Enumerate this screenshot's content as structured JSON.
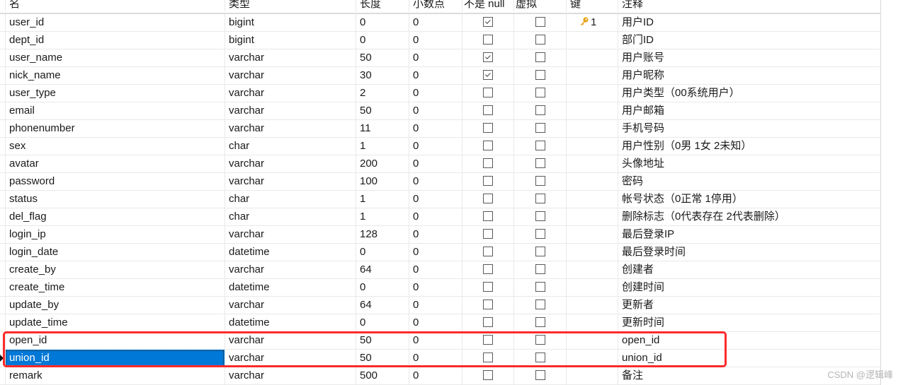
{
  "columns": {
    "name": "名",
    "type": "类型",
    "length": "长度",
    "decimals": "小数点",
    "not_null": "不是 null",
    "virtual": "虚拟",
    "key": "键",
    "comment": "注释"
  },
  "rows": [
    {
      "name": "user_id",
      "type": "bigint",
      "length": "0",
      "decimals": "0",
      "not_null": true,
      "virtual": false,
      "key": "1",
      "comment": "用户ID"
    },
    {
      "name": "dept_id",
      "type": "bigint",
      "length": "0",
      "decimals": "0",
      "not_null": false,
      "virtual": false,
      "key": "",
      "comment": "部门ID"
    },
    {
      "name": "user_name",
      "type": "varchar",
      "length": "50",
      "decimals": "0",
      "not_null": true,
      "virtual": false,
      "key": "",
      "comment": "用户账号"
    },
    {
      "name": "nick_name",
      "type": "varchar",
      "length": "30",
      "decimals": "0",
      "not_null": true,
      "virtual": false,
      "key": "",
      "comment": "用户昵称"
    },
    {
      "name": "user_type",
      "type": "varchar",
      "length": "2",
      "decimals": "0",
      "not_null": false,
      "virtual": false,
      "key": "",
      "comment": "用户类型（00系统用户）"
    },
    {
      "name": "email",
      "type": "varchar",
      "length": "50",
      "decimals": "0",
      "not_null": false,
      "virtual": false,
      "key": "",
      "comment": "用户邮箱"
    },
    {
      "name": "phonenumber",
      "type": "varchar",
      "length": "11",
      "decimals": "0",
      "not_null": false,
      "virtual": false,
      "key": "",
      "comment": "手机号码"
    },
    {
      "name": "sex",
      "type": "char",
      "length": "1",
      "decimals": "0",
      "not_null": false,
      "virtual": false,
      "key": "",
      "comment": "用户性别（0男 1女 2未知）"
    },
    {
      "name": "avatar",
      "type": "varchar",
      "length": "200",
      "decimals": "0",
      "not_null": false,
      "virtual": false,
      "key": "",
      "comment": "头像地址"
    },
    {
      "name": "password",
      "type": "varchar",
      "length": "100",
      "decimals": "0",
      "not_null": false,
      "virtual": false,
      "key": "",
      "comment": "密码"
    },
    {
      "name": "status",
      "type": "char",
      "length": "1",
      "decimals": "0",
      "not_null": false,
      "virtual": false,
      "key": "",
      "comment": "帐号状态（0正常 1停用）"
    },
    {
      "name": "del_flag",
      "type": "char",
      "length": "1",
      "decimals": "0",
      "not_null": false,
      "virtual": false,
      "key": "",
      "comment": "删除标志（0代表存在 2代表删除）"
    },
    {
      "name": "login_ip",
      "type": "varchar",
      "length": "128",
      "decimals": "0",
      "not_null": false,
      "virtual": false,
      "key": "",
      "comment": "最后登录IP"
    },
    {
      "name": "login_date",
      "type": "datetime",
      "length": "0",
      "decimals": "0",
      "not_null": false,
      "virtual": false,
      "key": "",
      "comment": "最后登录时间"
    },
    {
      "name": "create_by",
      "type": "varchar",
      "length": "64",
      "decimals": "0",
      "not_null": false,
      "virtual": false,
      "key": "",
      "comment": "创建者"
    },
    {
      "name": "create_time",
      "type": "datetime",
      "length": "0",
      "decimals": "0",
      "not_null": false,
      "virtual": false,
      "key": "",
      "comment": "创建时间"
    },
    {
      "name": "update_by",
      "type": "varchar",
      "length": "64",
      "decimals": "0",
      "not_null": false,
      "virtual": false,
      "key": "",
      "comment": "更新者"
    },
    {
      "name": "update_time",
      "type": "datetime",
      "length": "0",
      "decimals": "0",
      "not_null": false,
      "virtual": false,
      "key": "",
      "comment": "更新时间"
    },
    {
      "name": "open_id",
      "type": "varchar",
      "length": "50",
      "decimals": "0",
      "not_null": false,
      "virtual": false,
      "key": "",
      "comment": "open_id"
    },
    {
      "name": "union_id",
      "type": "varchar",
      "length": "50",
      "decimals": "0",
      "not_null": false,
      "virtual": false,
      "key": "",
      "comment": "union_id",
      "selected": true
    },
    {
      "name": "remark",
      "type": "varchar",
      "length": "500",
      "decimals": "0",
      "not_null": false,
      "virtual": false,
      "key": "",
      "comment": "备注"
    }
  ],
  "highlight_rows": [
    "open_id",
    "union_id"
  ],
  "colors": {
    "selection": "#0078d7",
    "highlight_border": "#ff2a2a",
    "key_icon": "#e8a21a"
  },
  "watermark": "CSDN @逻辑峰"
}
